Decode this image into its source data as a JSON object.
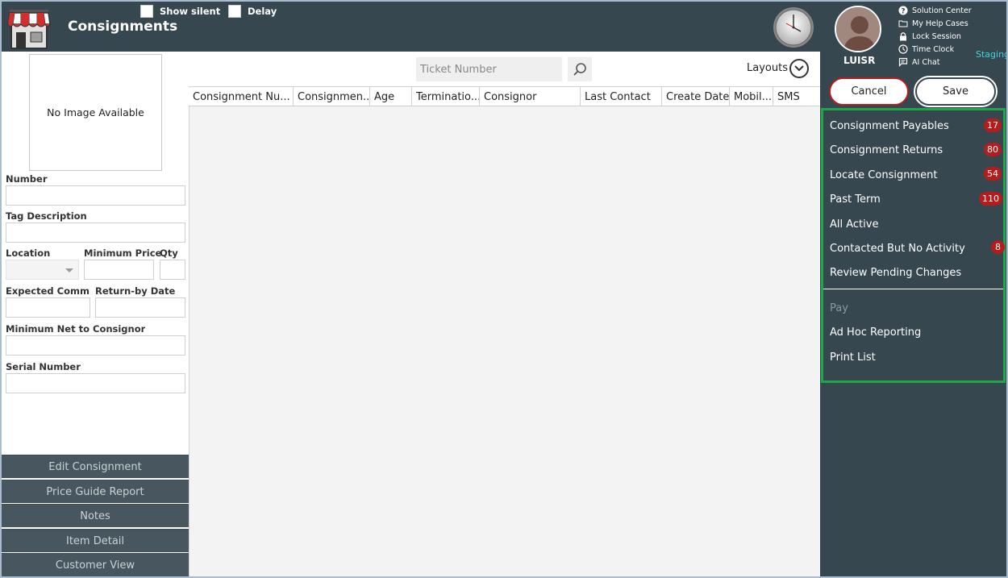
{
  "header": {
    "title": "Consignments",
    "show_silent_label": "Show silent",
    "delay_label": "Delay"
  },
  "left_panel": {
    "no_image_text": "No Image Available",
    "fields": {
      "number": "Number",
      "tag_description": "Tag Description",
      "location": "Location",
      "minimum_price": "Minimum Price",
      "qty": "Qty",
      "expected_commission": "Expected Commi...",
      "return_by_date": "Return-by Date",
      "minimum_net": "Minimum Net to Consignor",
      "serial_number": "Serial Number"
    },
    "buttons": [
      "Edit Consignment",
      "Price Guide Report",
      "Notes",
      "Item Detail",
      "Customer View"
    ]
  },
  "search": {
    "placeholder": "Ticket Number",
    "layouts_label": "Layouts"
  },
  "grid": {
    "columns": [
      "Consignment Nu...",
      "Consignmen...",
      "Age",
      "Terminatio...",
      "Consignor",
      "Last Contact",
      "Create Date",
      "Mobil...",
      "SMS"
    ]
  },
  "user": {
    "name": "LUISR",
    "environment": "Staging"
  },
  "top_links": [
    {
      "label": "Solution Center",
      "icon": "help-icon"
    },
    {
      "label": "My Help Cases",
      "icon": "folder-icon"
    },
    {
      "label": "Lock Session",
      "icon": "lock-icon"
    },
    {
      "label": "Time Clock",
      "icon": "clock-icon"
    },
    {
      "label": "AI Chat",
      "icon": "chat-icon"
    }
  ],
  "actions": {
    "cancel": "Cancel",
    "save": "Save"
  },
  "menu": {
    "items": [
      {
        "label": "Consignment Payables",
        "badge": "17"
      },
      {
        "label": "Consignment Returns",
        "badge": "80"
      },
      {
        "label": "Locate Consignment",
        "badge": "54"
      },
      {
        "label": "Past Term",
        "badge": "110"
      },
      {
        "label": "All Active",
        "badge": ""
      },
      {
        "label": "Contacted But No Activity",
        "badge": "8"
      },
      {
        "label": "Review Pending Changes",
        "badge": ""
      }
    ],
    "secondary": [
      {
        "label": "Pay",
        "disabled": true
      },
      {
        "label": "Ad Hoc Reporting",
        "disabled": false
      },
      {
        "label": "Print List",
        "disabled": false
      }
    ]
  },
  "colors": {
    "dark_bg": "#37474f",
    "badge": "#b71c1c",
    "menu_border": "#1fa64a",
    "staging": "#3dd6e0"
  }
}
